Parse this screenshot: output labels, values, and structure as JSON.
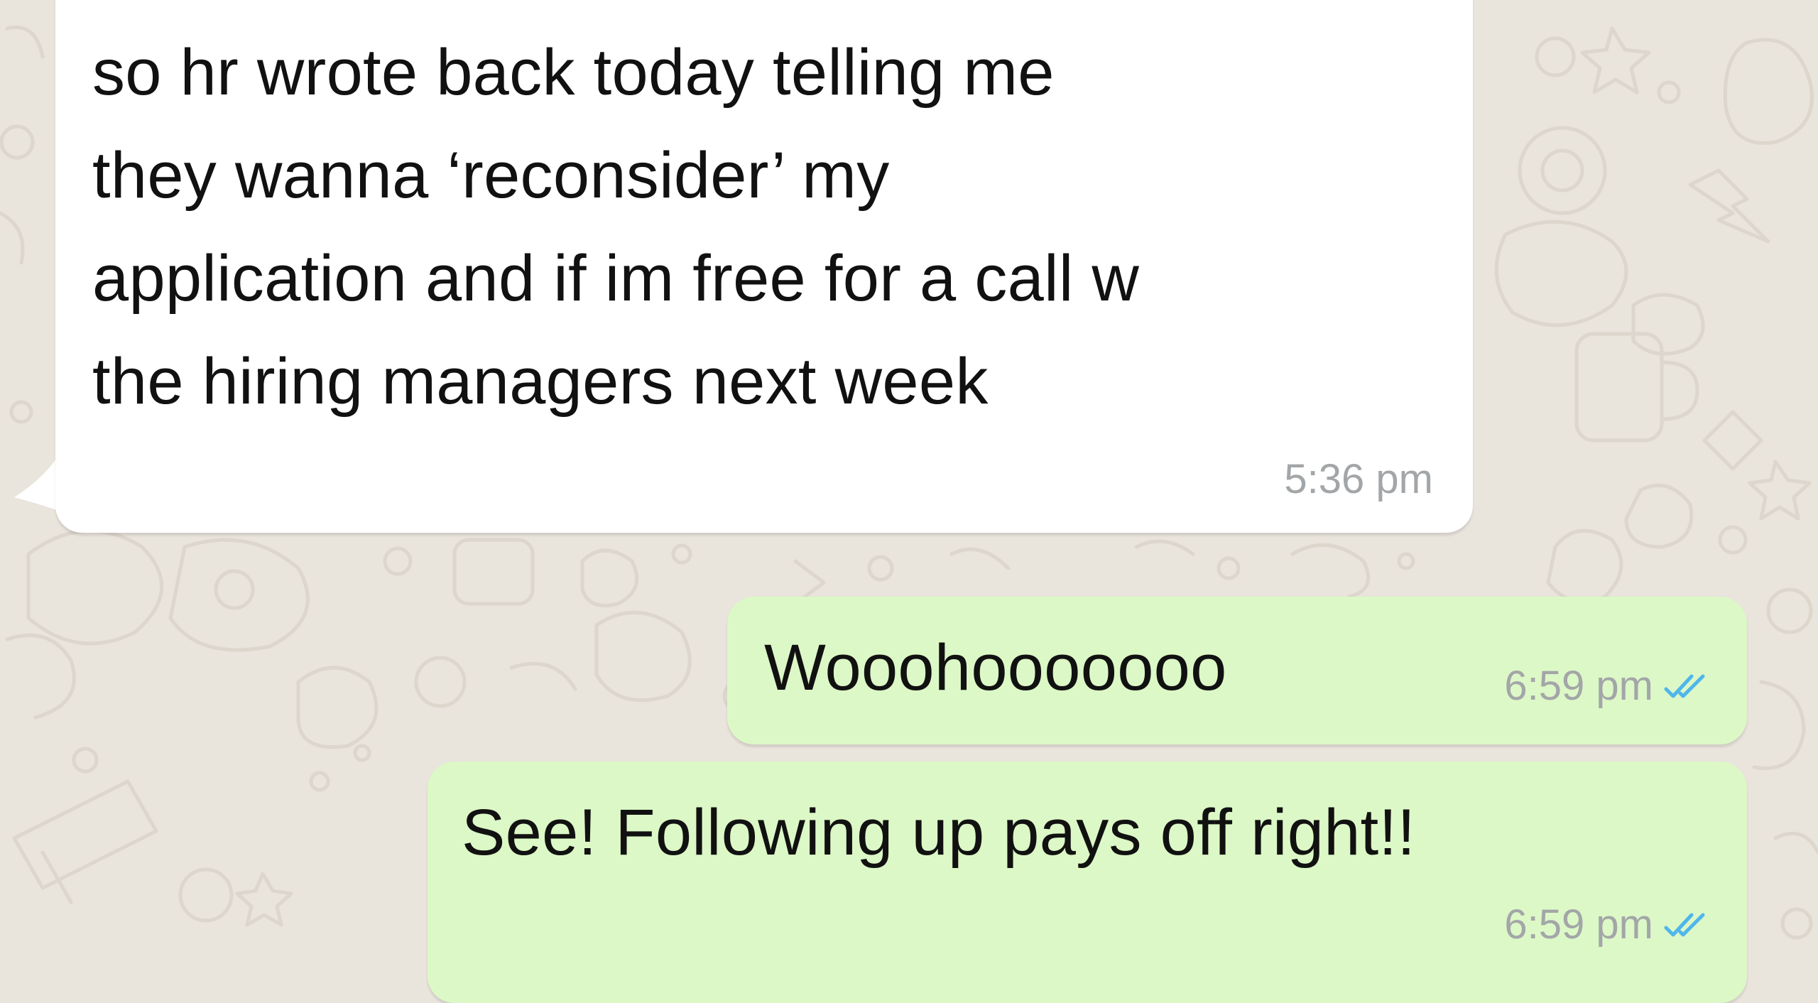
{
  "messages": [
    {
      "direction": "incoming",
      "text": "so hr wrote back today telling me\nthey wanna ‘reconsider’ my\napplication and if im free for a call w\nthe hiring managers next week",
      "time": "5:36 pm"
    },
    {
      "direction": "outgoing",
      "text": "Wooohooooooo",
      "time": "6:59 pm",
      "status_icon": "double-check-icon",
      "status_color": "#4fb6ec"
    },
    {
      "direction": "outgoing",
      "text": "See! Following up pays off right!!",
      "time": "6:59 pm",
      "status_icon": "double-check-icon",
      "status_color": "#4fb6ec"
    }
  ],
  "colors": {
    "background": "#e9e4dc",
    "doodle": "#dcd6cc",
    "incoming_bubble": "#ffffff",
    "outgoing_bubble": "#dcf8c6",
    "meta_text": "#a3a6a8",
    "message_text": "#111111"
  }
}
